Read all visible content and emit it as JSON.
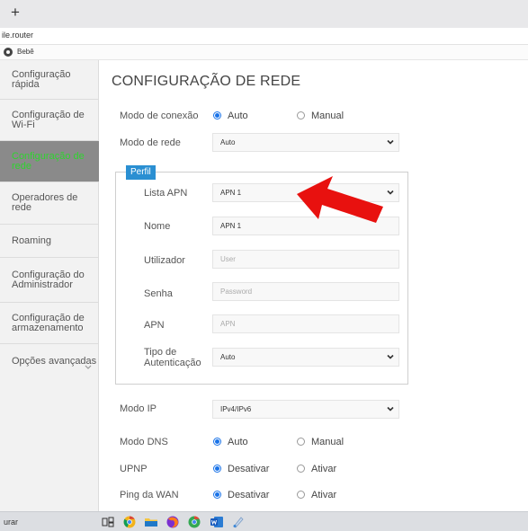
{
  "browser": {
    "new_tab_glyph": "+",
    "url": "ile.router",
    "bookmark": "Bebê"
  },
  "sidebar": {
    "items": [
      {
        "label": "Configuração rápida",
        "l1": "Configuração",
        "l2": "rápida"
      },
      {
        "label": "Configuração de Wi-Fi",
        "l1": "Configuração de",
        "l2": "Wi-Fi"
      },
      {
        "label": "Configuração de rede",
        "l1": "Configuração de",
        "l2": "rede",
        "active": true
      },
      {
        "label": "Operadores de rede",
        "l1": "Operadores de",
        "l2": "rede"
      },
      {
        "label": "Roaming",
        "l1": "Roaming",
        "l2": ""
      },
      {
        "label": "Configuração do Administrador",
        "l1": "Configuração do",
        "l2": "Administrador"
      },
      {
        "label": "Configuração de armazenamento",
        "l1": "Configuração de",
        "l2": "armazenamento"
      },
      {
        "label": "Opções avançadas",
        "l1": "Opções avançadas",
        "l2": ""
      }
    ],
    "active_color": "#2fd42f"
  },
  "main": {
    "title": "CONFIGURAÇÃO DE REDE",
    "connection_mode": {
      "label": "Modo de conexão",
      "options": [
        "Auto",
        "Manual"
      ],
      "selected": "Auto"
    },
    "network_mode": {
      "label": "Modo de rede",
      "value": "Auto"
    },
    "profile": {
      "legend": "Perfil",
      "apn_list": {
        "label": "Lista APN",
        "value": "APN 1"
      },
      "name": {
        "label": "Nome",
        "value": "APN 1"
      },
      "user": {
        "label": "Utilizador",
        "placeholder": "User"
      },
      "password": {
        "label": "Senha",
        "placeholder": "Password"
      },
      "apn": {
        "label": "APN",
        "placeholder": "APN"
      },
      "auth_type": {
        "label_l1": "Tipo de",
        "label_l2": "Autenticação",
        "value": "Auto"
      }
    },
    "ip_mode": {
      "label": "Modo IP",
      "value": "IPv4/IPv6"
    },
    "dns_mode": {
      "label": "Modo DNS",
      "options": [
        "Auto",
        "Manual"
      ],
      "selected": "Auto"
    },
    "upnp": {
      "label": "UPNP",
      "options": [
        "Desativar",
        "Ativar"
      ],
      "selected": "Desativar"
    },
    "wan_ping": {
      "label": "Ping da WAN",
      "options": [
        "Desativar",
        "Ativar"
      ],
      "selected": "Desativar"
    }
  },
  "taskbar": {
    "search_fragment": "urar"
  },
  "colors": {
    "accent": "#1a73e8",
    "perfil_tag": "#2a8fd2",
    "arrow": "#e8110f"
  }
}
